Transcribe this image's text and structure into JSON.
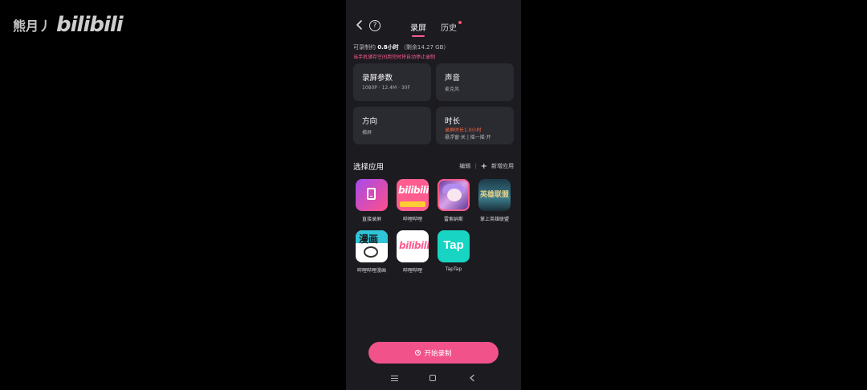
{
  "watermark": {
    "user": "熊月丿",
    "logo": "bilibili"
  },
  "header": {
    "tabs": [
      {
        "label": "录屏",
        "active": true
      },
      {
        "label": "历史",
        "active": false,
        "has_dot": true
      }
    ]
  },
  "storage": {
    "prefix": "可录制约",
    "duration": "0.8小时",
    "remaining": "（剩余14.27 GB）",
    "warning": "当手机储存空间用完时将自动停止录制"
  },
  "cards": [
    {
      "title": "录屏参数",
      "value": "1080P · 12.4M · 30F"
    },
    {
      "title": "声音",
      "value": "麦克风"
    },
    {
      "title": "方向",
      "value": "横屏"
    },
    {
      "title": "时长",
      "value_highlight": "录屏时长1.0小时",
      "value": "悬浮窗·关 | 摇一摇·开"
    }
  ],
  "apps_section": {
    "title": "选择应用",
    "edit_label": "编辑",
    "separator": "|",
    "add_label": "新增应用"
  },
  "apps": [
    {
      "label": "直接录屏",
      "icon": "screen-record-icon"
    },
    {
      "label": "哔哩哔哩",
      "icon": "bilibili-concept-icon",
      "icon_text": "bilibili"
    },
    {
      "label": "雷索纳斯",
      "icon": "anime-game-icon"
    },
    {
      "label": "掌上英雄联盟",
      "icon": "lol-icon",
      "icon_text": "英雄联盟"
    },
    {
      "label": "哔哩哔哩漫画",
      "icon": "manga-icon",
      "icon_text": "漫画"
    },
    {
      "label": "哔哩哔哩",
      "icon": "bilibili-icon",
      "icon_text": "bilibili"
    },
    {
      "label": "TapTap",
      "icon": "taptap-icon",
      "icon_text": "Tap"
    }
  ],
  "start_button": {
    "label": "开始录制"
  },
  "colors": {
    "accent": "#f2528a",
    "background": "#1b1b20",
    "card": "#2a2a31",
    "highlight": "#ff6a3d"
  }
}
